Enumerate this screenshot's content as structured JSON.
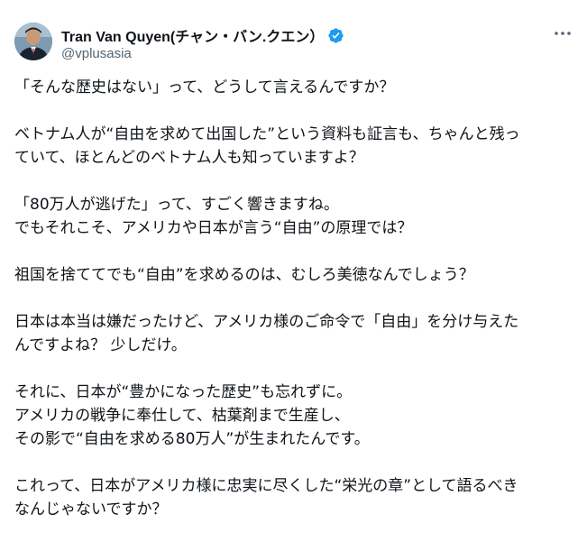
{
  "author": {
    "display_name": "Tran Van Quyen(チャン・バン.クエン）",
    "handle": "@vplusasia",
    "verified_icon": "verified-badge-icon",
    "verified_color": "#1d9bf0"
  },
  "menu": {
    "icon": "more-horizontal-icon"
  },
  "tweet": {
    "paragraphs": [
      {
        "lines": [
          "「そんな歴史はない」って、どうして言えるんですか？"
        ]
      },
      {
        "lines": [
          "ベトナム人が“自由を求めて出国した”という資料も証言も、ちゃんと残っ",
          "ていて、ほとんどのベトナム人も知っていますよ？"
        ]
      },
      {
        "lines": [
          "「80万人が逃げた」って、すごく響きますね。",
          "でもそれこそ、アメリカや日本が言う“自由”の原理では？"
        ]
      },
      {
        "lines": [
          "祖国を捨ててでも“自由”を求めるのは、むしろ美徳なんでしょう？"
        ]
      },
      {
        "lines": [
          "日本は本当は嫌だったけど、アメリカ様のご命令で「自由」を分け与えた",
          "んですよね？ 少しだけ。"
        ]
      },
      {
        "lines": [
          "それに、日本が“豊かになった歴史”も忘れずに。",
          "アメリカの戦争に奉仕して、枯葉剤まで生産し、",
          "その影で“自由を求める80万人”が生まれたんです。"
        ]
      },
      {
        "lines": [
          "これって、日本がアメリカ様に忠実に尽くした“栄光の章”として語るべき",
          "なんじゃないですか？"
        ]
      }
    ]
  }
}
